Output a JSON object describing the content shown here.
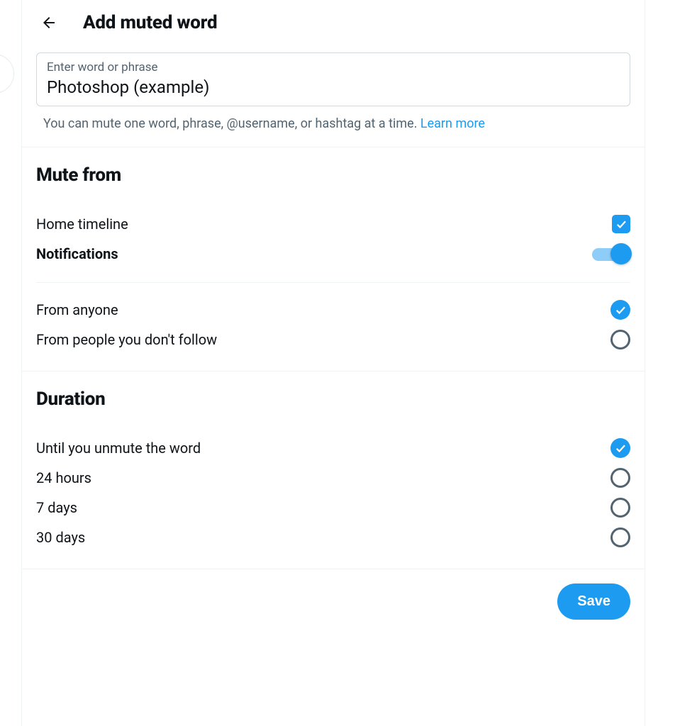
{
  "header": {
    "title": "Add muted word"
  },
  "input": {
    "label": "Enter word or phrase",
    "value": "Photoshop (example)",
    "helper_text": "You can mute one word, phrase, @username, or hashtag at a time. ",
    "learn_more": "Learn more"
  },
  "mute_from": {
    "title": "Mute from",
    "home_timeline": {
      "label": "Home timeline",
      "checked": true
    },
    "notifications": {
      "label": "Notifications",
      "enabled": true
    },
    "options": [
      {
        "label": "From anyone",
        "selected": true
      },
      {
        "label": "From people you don't follow",
        "selected": false
      }
    ]
  },
  "duration": {
    "title": "Duration",
    "options": [
      {
        "label": "Until you unmute the word",
        "selected": true
      },
      {
        "label": "24 hours",
        "selected": false
      },
      {
        "label": "7 days",
        "selected": false
      },
      {
        "label": "30 days",
        "selected": false
      }
    ]
  },
  "footer": {
    "save_label": "Save"
  },
  "colors": {
    "accent": "#1d9bf0",
    "text": "#0f1419",
    "muted": "#536471",
    "border": "#eff3f4"
  }
}
